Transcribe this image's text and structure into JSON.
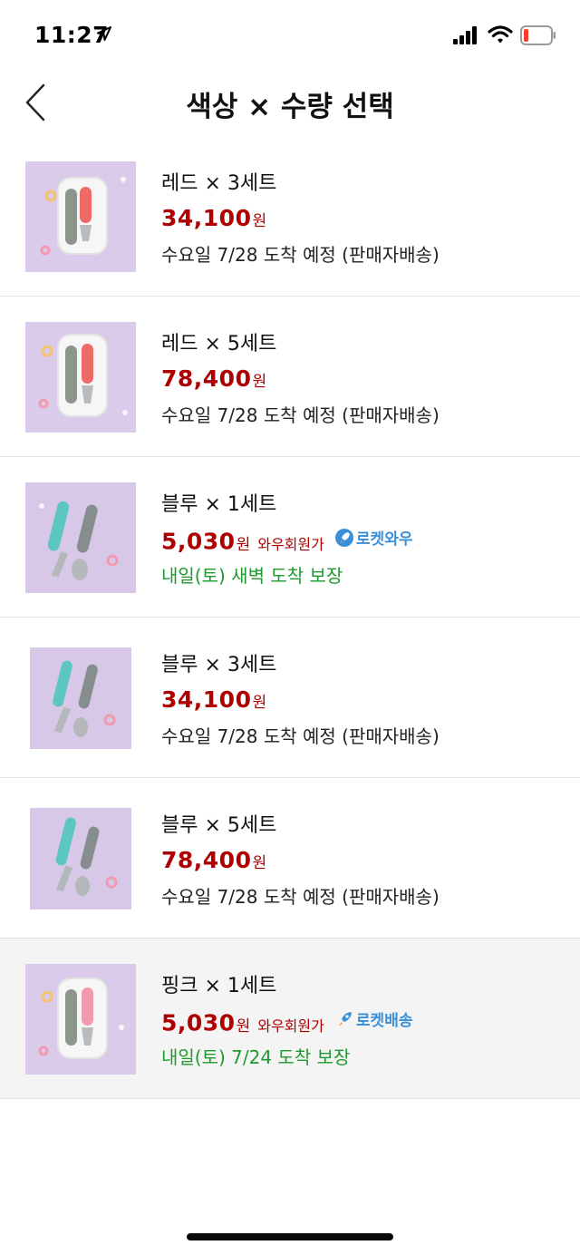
{
  "status_bar": {
    "time": "11:27"
  },
  "header": {
    "title": "색상 × 수량 선택"
  },
  "currency_unit": "원",
  "items": [
    {
      "name": "레드 × 3세트",
      "price": "34,100",
      "member_label": "",
      "badge": "",
      "delivery": "수요일 7/28  도착 예정 (판매자배송)",
      "delivery_style": "normal",
      "color_scheme": "red"
    },
    {
      "name": "레드 × 5세트",
      "price": "78,400",
      "member_label": "",
      "badge": "",
      "delivery": "수요일 7/28  도착 예정 (판매자배송)",
      "delivery_style": "normal",
      "color_scheme": "red"
    },
    {
      "name": "블루 × 1세트",
      "price": "5,030",
      "member_label": "와우회원가",
      "badge": "로켓와우",
      "delivery": "내일(토) 새벽 도착 보장",
      "delivery_style": "green",
      "color_scheme": "blue"
    },
    {
      "name": "블루 × 3세트",
      "price": "34,100",
      "member_label": "",
      "badge": "",
      "delivery": "수요일 7/28  도착 예정 (판매자배송)",
      "delivery_style": "normal",
      "color_scheme": "blue"
    },
    {
      "name": "블루 × 5세트",
      "price": "78,400",
      "member_label": "",
      "badge": "",
      "delivery": "수요일 7/28  도착 예정 (판매자배송)",
      "delivery_style": "normal",
      "color_scheme": "blue"
    },
    {
      "name": "핑크 × 1세트",
      "price": "5,030",
      "member_label": "와우회원가",
      "badge": "로켓배송",
      "delivery": "내일(토) 7/24  도착 보장",
      "delivery_style": "green",
      "color_scheme": "pink",
      "selected": true
    }
  ],
  "colors": {
    "price": "#ae0000",
    "delivery_green": "#1f9a2e",
    "badge_blue": "#3a8fd9",
    "selected_bg": "#f4f4f4"
  },
  "icons": {
    "back": "chevron-left-icon",
    "badge": "rocket-icon"
  }
}
